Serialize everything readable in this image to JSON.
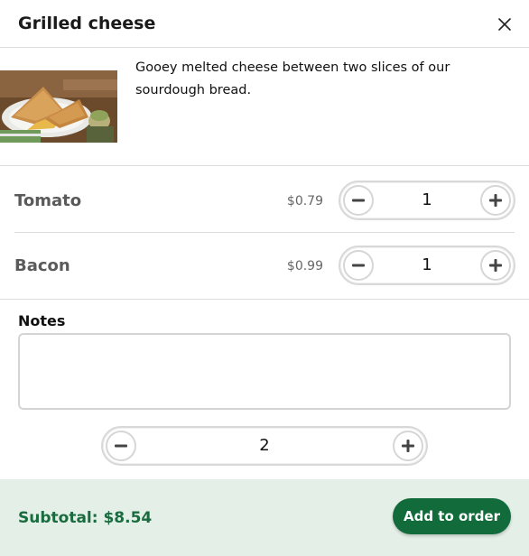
{
  "dialog": {
    "title": "Grilled cheese",
    "close_icon": "close-icon"
  },
  "product": {
    "description": "Gooey melted cheese between two slices of our sourdough bread.",
    "image_alt": "grilled cheese sandwich photo"
  },
  "options": [
    {
      "name": "Tomato",
      "price": "$0.79",
      "quantity": "1"
    },
    {
      "name": "Bacon",
      "price": "$0.99",
      "quantity": "1"
    }
  ],
  "notes": {
    "label": "Notes",
    "value": "",
    "placeholder": ""
  },
  "item_quantity": "2",
  "footer": {
    "subtotal": "Subtotal: $8.54",
    "add_label": "Add to order"
  },
  "colors": {
    "accent": "#116b3a",
    "footer_bg": "#e3efe7",
    "subtotal_text": "#1a6b3f"
  },
  "icons": {
    "minus": "minus-icon",
    "plus": "plus-icon"
  }
}
